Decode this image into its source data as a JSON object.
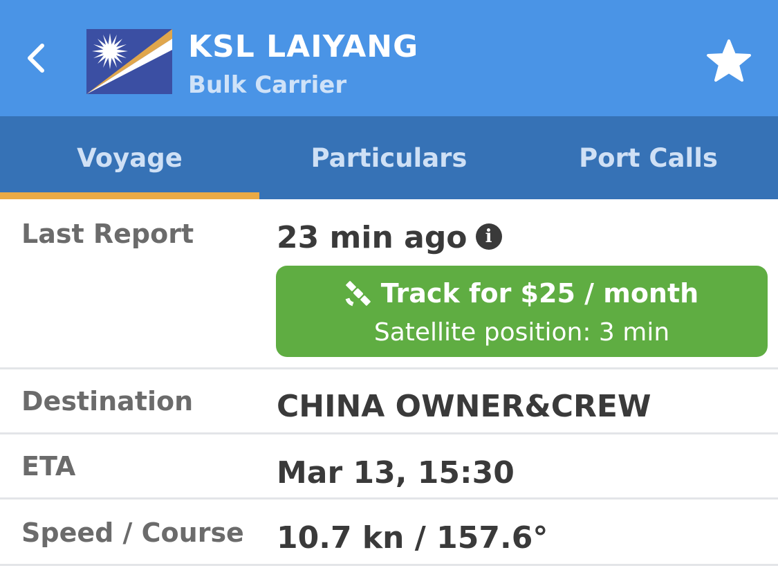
{
  "header": {
    "vessel_name": "KSL LAIYANG",
    "vessel_type": "Bulk Carrier",
    "background_color": "#4a94e6",
    "back_icon": "chevron-left-icon",
    "favorite_icon": "star-icon",
    "flag": "marshall-islands-flag"
  },
  "tabs": [
    {
      "label": "Voyage",
      "active": true
    },
    {
      "label": "Particulars",
      "active": false
    },
    {
      "label": "Port Calls",
      "active": false
    }
  ],
  "voyage": {
    "last_report": {
      "label": "Last Report",
      "value": "23 min ago",
      "info_icon": "info-icon"
    },
    "track_offer": {
      "icon": "satellite-icon",
      "title": "Track for $25 / month",
      "subtitle": "Satellite position: 3 min",
      "color": "#5fad42"
    },
    "destination": {
      "label": "Destination",
      "value": "CHINA OWNER&CREW"
    },
    "eta": {
      "label": "ETA",
      "value": "Mar 13, 15:30"
    },
    "speed_course": {
      "label": "Speed / Course",
      "value": "10.7 kn / 157.6°"
    }
  },
  "colors": {
    "tab_bar": "#3672b6",
    "tab_active_indicator": "#eaaa45"
  }
}
